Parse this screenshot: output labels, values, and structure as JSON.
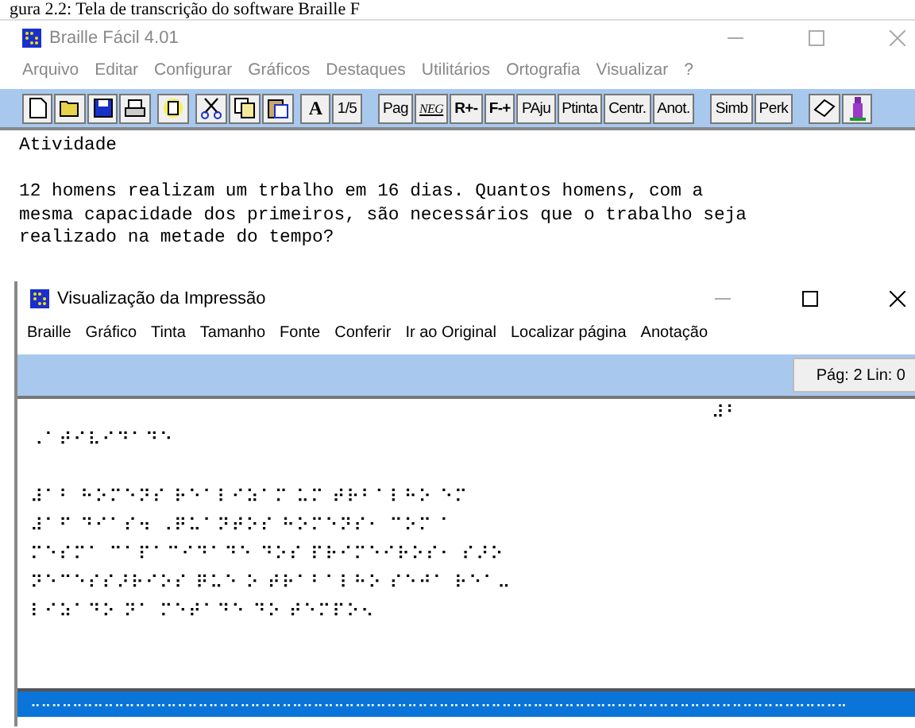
{
  "caption": "gura 2.2: Tela de transcrição do software Braille F",
  "main_window": {
    "title": "Braille Fácil 4.01",
    "menu": [
      "Arquivo",
      "Editar",
      "Configurar",
      "Gráficos",
      "Destaques",
      "Utilitários",
      "Ortografia",
      "Visualizar",
      "?"
    ],
    "toolbar": {
      "format_buttons": [
        "A",
        "1/5"
      ],
      "layout_buttons": [
        "Pag",
        "NEG",
        "R+-",
        "F-+",
        "PAju",
        "Ptinta",
        "Centr.",
        "Anot."
      ],
      "tool_buttons": [
        "Simb",
        "Perk"
      ]
    },
    "editor_lines": [
      "Atividade",
      "12 homens realizam um trbalho em 16 dias. Quantos homens, com a",
      "mesma capacidade dos primeiros, são necessários que o trabalho seja",
      "realizado na metade do tempo?"
    ]
  },
  "preview_window": {
    "title": "Visualização da Impressão",
    "menu": [
      "Braille",
      "Gráfico",
      "Tinta",
      "Tamanho",
      "Fonte",
      "Conferir",
      "Ir ao Original",
      "Localizar página",
      "Anotação"
    ],
    "page_status": "Pág: 2  Lin: 0",
    "page_number": "⠼⠃",
    "braille_lines": [
      "⠠⠁⠞⠊⠧⠊⠙⠁⠙⠑",
      "⠼⠁⠃ ⠓⠕⠍⠑⠝⠎ ⠗⠑⠁⠇⠊⠵⠁⠍ ⠥⠍ ⠞⠗⠃⠁⠇⠓⠕ ⠑⠍",
      "⠼⠁⠋ ⠙⠊⠁⠎⠲ ⠠⠟⠥⠁⠝⠞⠕⠎ ⠓⠕⠍⠑⠝⠎⠂ ⠉⠕⠍ ⠁",
      "⠍⠑⠎⠍⠁ ⠉⠁⠏⠁⠉⠊⠙⠁⠙⠑ ⠙⠕⠎ ⠏⠗⠊⠍⠑⠊⠗⠕⠎⠂ ⠎⠜⠕",
      "⠝⠑⠉⠑⠎⠎⠜⠗⠊⠕⠎ ⠟⠥⠑ ⠕ ⠞⠗⠁⠃⠁⠇⠓⠕ ⠎⠑⠚⠁ ⠗⠑⠁⠤",
      "⠇⠊⠵⠁⠙⠕ ⠝⠁ ⠍⠑⠞⠁⠙⠑ ⠙⠕ ⠞⠑⠍⠏⠕⠢"
    ],
    "selected_line": "⠤⠤⠤⠤⠤⠤⠤⠤⠤⠤⠤⠤⠤⠤⠤⠤⠤⠤⠤⠤⠤⠤⠤⠤⠤⠤⠤⠤⠤⠤⠤⠤⠤⠤⠤⠤⠤⠤⠤⠤⠤⠤⠤⠤⠤⠤⠤⠤⠤⠤⠤⠤⠤⠤⠤⠤⠤⠤⠤⠤⠤⠤⠤⠤⠤⠤⠤⠤⠤⠤⠤⠤⠤⠤⠤⠤⠤⠤"
  }
}
